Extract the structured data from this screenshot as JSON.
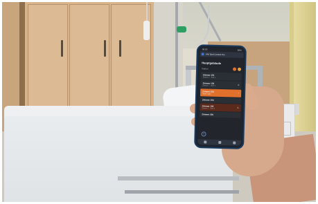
{
  "phone_app": {
    "status_time": "08:20",
    "status_battery": "89%",
    "app_title": "VIVI Bed Control Pro",
    "section_title": "Hauptgebäude",
    "header_left": "Station",
    "indicator_colors": [
      "#e0702c",
      "#e8a13a"
    ],
    "rows": [
      {
        "name": "Zimmer 101",
        "sub": "Station 1 · Bett 1",
        "value": "",
        "state": "normal"
      },
      {
        "name": "Zimmer 102",
        "sub": "Station 1 · Bett 2",
        "value": "⚠",
        "state": "normal"
      },
      {
        "name": "Zimmer 103",
        "sub": "Alarm aktiv",
        "value": "!",
        "state": "active"
      },
      {
        "name": "Zimmer 104",
        "sub": "",
        "value": "",
        "state": "normal"
      },
      {
        "name": "Zimmer 105",
        "sub": "Station 1 · Bett 5",
        "value": "⚠",
        "state": "dark"
      },
      {
        "name": "Zimmer 106",
        "sub": "",
        "value": "",
        "state": "normal"
      }
    ],
    "help_symbol": "?"
  }
}
